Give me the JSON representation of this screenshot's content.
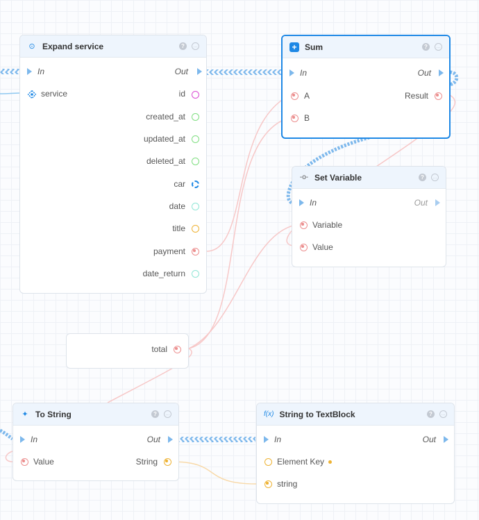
{
  "nodes": {
    "expand_service": {
      "title": "Expand service",
      "in_label": "In",
      "out_label": "Out",
      "service_label": "service",
      "outputs": [
        "id",
        "created_at",
        "updated_at",
        "deleted_at",
        "car",
        "date",
        "title",
        "payment",
        "date_return"
      ]
    },
    "sum": {
      "title": "Sum",
      "in_label": "In",
      "out_label": "Out",
      "input_a": "A",
      "input_b": "B",
      "result_label": "Result"
    },
    "set_variable": {
      "title": "Set Variable",
      "in_label": "In",
      "out_label": "Out",
      "variable_label": "Variable",
      "value_label": "Value"
    },
    "total": {
      "label": "total"
    },
    "to_string": {
      "title": "To String",
      "in_label": "In",
      "out_label": "Out",
      "value_label": "Value",
      "string_label": "String"
    },
    "string_to_textblock": {
      "title": "String to TextBlock",
      "icon_text": "f(x)",
      "in_label": "In",
      "out_label": "Out",
      "element_key_label": "Element Key",
      "string_label": "string"
    }
  },
  "icons": {
    "help": "?",
    "comment": "…",
    "sum_icon": "+",
    "expand_icon": "⊙",
    "set_icon": "-o-",
    "to_string_icon": "✦"
  },
  "colors": {
    "exec_wire": "#7db8ec",
    "selected_border": "#1e88e5",
    "number_pin": "#ec8f8f",
    "string_pin": "#eeb233"
  }
}
